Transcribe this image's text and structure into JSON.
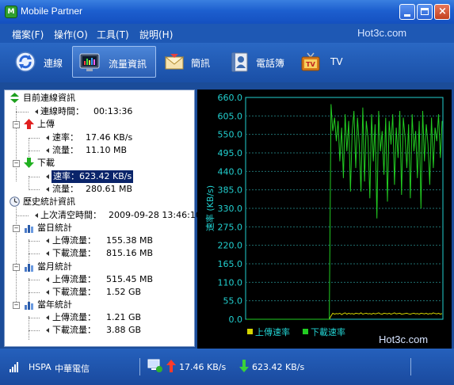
{
  "window": {
    "title": "Mobile Partner"
  },
  "menu": {
    "items": [
      "檔案(F)",
      "操作(O)",
      "工具(T)",
      "說明(H)"
    ],
    "watermark": "Hot3c.com"
  },
  "toolbar": {
    "items": [
      "連線",
      "流量資訊",
      "簡訊",
      "電話簿",
      "TV"
    ],
    "active_index": 1
  },
  "tree": {
    "current": {
      "title": "目前連線資訊",
      "conn_time_label": "連線時間：",
      "conn_time": "00:13:36",
      "upload": {
        "title": "上傳",
        "rate_label": "速率：",
        "rate": "17.46 KB/s",
        "traffic_label": "流量：",
        "traffic": "11.10 MB"
      },
      "download": {
        "title": "下載",
        "rate_label": "速率：",
        "rate": "623.42 KB/s",
        "traffic_label": "流量：",
        "traffic": "280.61 MB"
      }
    },
    "history": {
      "title": "歷史統計資訊",
      "last_clear_label": "上次清空時間：",
      "last_clear": "2009-09-28 13:46:10",
      "day": {
        "title": "當日統計",
        "up_label": "上傳流量：",
        "up": "155.38 MB",
        "down_label": "下載流量：",
        "down": "815.16 MB"
      },
      "month": {
        "title": "當月統計",
        "up_label": "上傳流量：",
        "up": "515.45 MB",
        "down_label": "下載流量：",
        "down": "1.52 GB"
      },
      "year": {
        "title": "當年統計",
        "up_label": "上傳流量：",
        "up": "1.21 GB",
        "down_label": "下載流量：",
        "down": "3.88 GB"
      }
    }
  },
  "chart_data": {
    "type": "line",
    "ylabel": "速率 (KB/s)",
    "ylim": [
      0,
      660
    ],
    "yticks": [
      "660.0",
      "605.0",
      "550.0",
      "495.0",
      "440.0",
      "385.0",
      "330.0",
      "275.0",
      "220.0",
      "165.0",
      "110.0",
      "55.0",
      "0.0"
    ],
    "grid": true,
    "legend_position": "bottom",
    "series": [
      {
        "name": "上傳速率",
        "color": "#d4d400",
        "values": [
          0,
          0,
          0,
          0,
          0,
          0,
          0,
          0,
          0,
          0,
          0,
          0,
          0,
          0,
          0,
          0,
          0,
          0,
          0,
          0,
          0,
          0,
          0,
          0,
          0,
          0,
          0,
          0,
          0,
          0,
          0,
          0,
          0,
          0,
          0,
          0,
          0,
          0,
          0,
          0,
          0,
          0,
          0,
          0,
          0,
          0,
          0,
          0,
          10,
          18,
          15,
          17,
          16,
          18,
          14,
          17,
          19,
          15,
          18,
          16,
          17,
          15,
          18,
          17,
          16,
          19,
          15,
          17,
          18,
          16,
          17,
          15,
          18,
          16,
          17,
          19,
          16,
          15,
          18,
          17,
          16,
          18,
          15,
          17,
          19,
          16,
          17,
          18,
          15,
          16,
          17,
          18,
          16,
          15,
          17,
          18,
          16,
          17,
          15,
          18,
          17,
          16,
          18,
          15,
          17,
          16,
          19,
          17,
          16,
          18,
          15,
          17
        ]
      },
      {
        "name": "下載速率",
        "color": "#22cc22",
        "values": [
          0,
          0,
          0,
          0,
          0,
          0,
          0,
          0,
          0,
          0,
          0,
          0,
          0,
          0,
          0,
          0,
          0,
          0,
          0,
          0,
          0,
          0,
          0,
          0,
          0,
          0,
          0,
          0,
          0,
          0,
          0,
          0,
          0,
          0,
          0,
          0,
          0,
          0,
          0,
          0,
          0,
          0,
          0,
          0,
          0,
          0,
          0,
          0,
          640,
          560,
          600,
          530,
          590,
          470,
          570,
          420,
          610,
          500,
          590,
          380,
          560,
          620,
          450,
          600,
          520,
          380,
          630,
          410,
          590,
          540,
          360,
          610,
          470,
          580,
          300,
          620,
          500,
          560,
          430,
          600,
          350,
          590,
          520,
          610,
          400,
          570,
          480,
          620,
          370,
          600,
          540,
          450,
          580,
          360,
          610,
          500,
          560,
          420,
          590,
          330,
          620,
          470,
          580,
          520,
          400,
          600,
          450,
          570,
          530,
          610,
          480,
          590
        ]
      }
    ]
  },
  "status": {
    "network": "HSPA",
    "carrier": "中華電信",
    "upload_rate": "17.46 KB/s",
    "download_rate": "623.42 KB/s",
    "watermark": "Hot3c.com"
  },
  "colors": {
    "accent": "#1e58b4",
    "chart_grid": "#1f6f6f",
    "axis_text": "#22d0d0"
  }
}
